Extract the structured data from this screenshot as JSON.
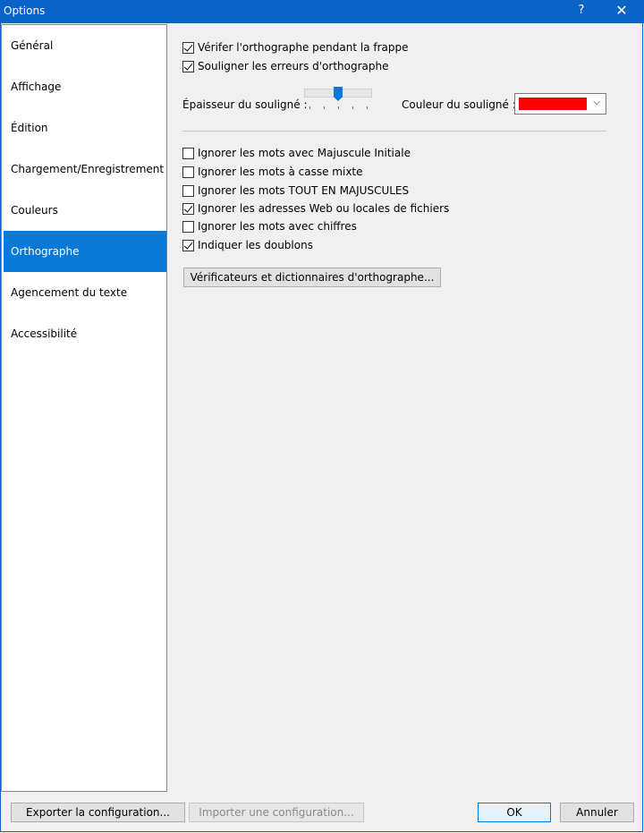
{
  "window": {
    "title": "Options",
    "help_glyph": "?",
    "close_glyph": "✕"
  },
  "sidebar": {
    "items": [
      {
        "label": "Général",
        "selected": false
      },
      {
        "label": "Affichage",
        "selected": false
      },
      {
        "label": "Édition",
        "selected": false
      },
      {
        "label": "Chargement/Enregistrement",
        "selected": false
      },
      {
        "label": "Couleurs",
        "selected": false
      },
      {
        "label": "Orthographe",
        "selected": true
      },
      {
        "label": "Agencement du texte",
        "selected": false
      },
      {
        "label": "Accessibilité",
        "selected": false
      }
    ]
  },
  "spelling": {
    "check_while_typing": {
      "label": "Vérifer l'orthographe pendant la frappe",
      "checked": true
    },
    "underline_errors": {
      "label": "Souligner les erreurs d'orthographe",
      "checked": true
    },
    "thickness_label": "Épaisseur du souligné :",
    "thickness_level": 0.5,
    "color_label": "Couleur du souligné :",
    "underline_color": "#ff0000",
    "options": [
      {
        "label": "Ignorer les mots avec Majuscule Initiale",
        "checked": false
      },
      {
        "label": "Ignorer les mots à casse mixte",
        "checked": false
      },
      {
        "label": "Ignorer les mots TOUT EN MAJUSCULES",
        "checked": false
      },
      {
        "label": "Ignorer les adresses Web ou locales de fichiers",
        "checked": true
      },
      {
        "label": "Ignorer les mots avec chiffres",
        "checked": false
      },
      {
        "label": "Indiquer les doublons",
        "checked": true
      }
    ],
    "dictionaries_button": "Vérificateurs et dictionnaires d'orthographe..."
  },
  "footer": {
    "export_button": "Exporter la configuration...",
    "import_button": "Importer une configuration...",
    "ok_button": "OK",
    "cancel_button": "Annuler"
  },
  "colors": {
    "titlebar": "#0a64c8",
    "selection": "#0a78d7"
  },
  "icons": {
    "help": "help-icon",
    "close": "close-icon",
    "dropdown": "chevron-down-icon"
  }
}
